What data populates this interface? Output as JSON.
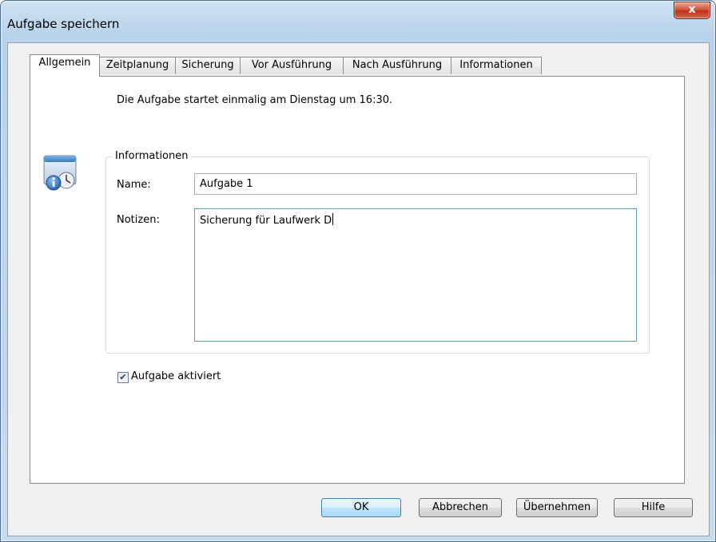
{
  "window": {
    "title": "Aufgabe speichern",
    "close_glyph": "x"
  },
  "tabs": [
    {
      "label": "Allgemein",
      "active": true
    },
    {
      "label": "Zeitplanung"
    },
    {
      "label": "Sicherung"
    },
    {
      "label": "Vor Ausführung"
    },
    {
      "label": "Nach Ausführung"
    },
    {
      "label": "Informationen"
    }
  ],
  "general": {
    "status_text": "Die Aufgabe startet einmalig am Dienstag um 16:30.",
    "icon": "task-info-icon",
    "group_title": "Informationen",
    "name_label": "Name:",
    "name_value": "Aufgabe 1",
    "notes_label": "Notizen:",
    "notes_value": "Sicherung für Laufwerk D",
    "enabled_label": "Aufgabe aktiviert",
    "enabled_checked": true,
    "check_glyph": "✔"
  },
  "buttons": {
    "ok": "OK",
    "cancel": "Abbrechen",
    "apply": "Übernehmen",
    "help": "Hilfe"
  },
  "colors": {
    "close_button": "#c1301a",
    "focus_border": "#5c9dd8",
    "default_button": "#3c7fb1"
  }
}
